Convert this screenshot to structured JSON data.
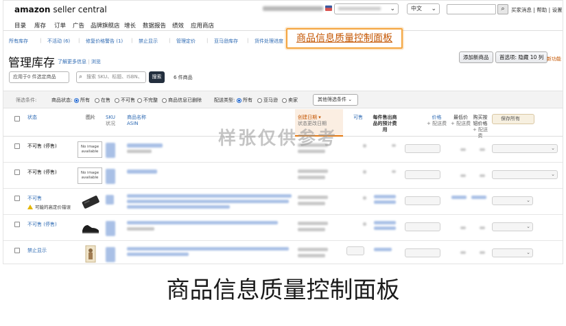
{
  "app": {
    "logo_brand": "amazon",
    "logo_sub": "seller central"
  },
  "topbar": {
    "language": "中文",
    "search_button_icon": "search-icon",
    "links": "买家消息 | 帮助 | 设置"
  },
  "main_nav": [
    "目录",
    "库存",
    "订单",
    "广告",
    "品牌旗舰店",
    "增长",
    "数据报告",
    "绩效",
    "应用商店"
  ],
  "sub_nav": [
    "所有库存",
    "不活动 (6)",
    "修复价格警告 (1)",
    "禁止显示",
    "管理定价",
    "亚马逊库存",
    "货件处理进度"
  ],
  "page": {
    "title": "管理库存",
    "learn_more": "了解更多信息",
    "tour": "浏览",
    "add_product_button": "添加新商品",
    "preferences_button": "首选项: 隐藏 10 列",
    "new_feature_link": "新功能"
  },
  "callout": "商品信息质量控制面板",
  "toolbar": {
    "bulk_select": "应用于0 件选定商品",
    "search_placeholder": "搜索 SKU、标题、ISBN、",
    "search_button": "搜索",
    "result_count": "6 件商品"
  },
  "filters": {
    "label": "筛选条件:",
    "listing_status_label": "商品状态:",
    "listing_status_options": [
      "所有",
      "在售",
      "不可售",
      "不完整",
      "商品信息已删除"
    ],
    "fulfillment_label": "配送类型:",
    "fulfillment_options": [
      "所有",
      "亚马逊",
      "卖家"
    ],
    "more_filters": "其他筛选条件"
  },
  "table": {
    "headers": {
      "status": "状态",
      "image": "图片",
      "sku": "SKU",
      "sku_sub": "状况",
      "name": "商品名称",
      "name_sub": "ASIN",
      "created": "创建日期",
      "created_sub": "状态更改日期",
      "available": "可售",
      "fee": "每件售出商品的预计费用",
      "price": "价格",
      "price_sub": "+ 配送费",
      "lowest": "最低价",
      "lowest_sub": "+ 配送费",
      "buybox": "购买按钮价格",
      "buybox_sub": "+ 配送费",
      "save_all": "保存所有"
    },
    "rows": [
      {
        "status": "不可售 (停售)",
        "warning": "",
        "image": "No image available",
        "status_color": "#111111"
      },
      {
        "status": "不可售 (停售)",
        "warning": "",
        "image": "No image available",
        "status_color": "#111111"
      },
      {
        "status": "不可售",
        "warning": "可能的高定价错误",
        "image": "power-bank-photo",
        "status_color": "#2e6ab3"
      },
      {
        "status": "不可售 (停售)",
        "warning": "",
        "image": "shoe-photo",
        "status_color": "#2e6ab3"
      },
      {
        "status": "禁止显示",
        "warning": "",
        "image": "figurine-photo",
        "status_color": "#2e6ab3"
      }
    ]
  },
  "watermark": "样张仅供参考",
  "caption": "商品信息质量控制面板"
}
